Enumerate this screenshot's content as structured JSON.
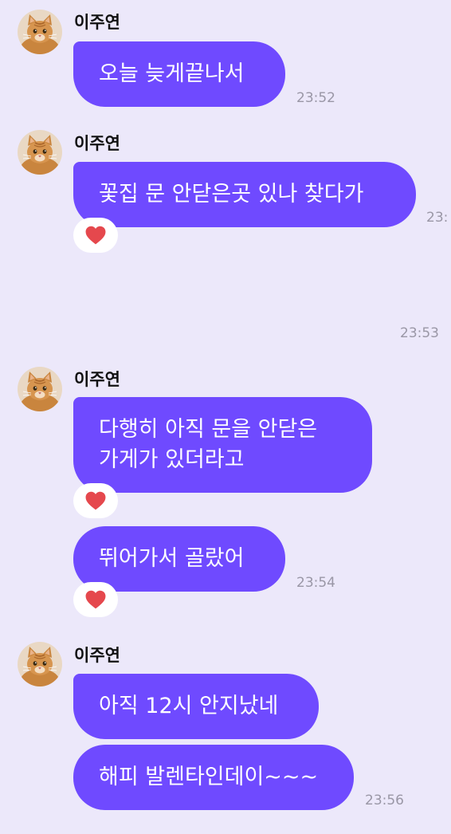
{
  "messages": [
    {
      "sender": "이주연",
      "lines": [
        "오늘 늦게끝나서"
      ],
      "time": "23:52"
    },
    {
      "sender": "이주연",
      "lines": [
        "꽃집 문 안닫은곳 있나 찾다가"
      ],
      "time": "23:"
    },
    {
      "time": "23:53"
    },
    {
      "sender": "이주연",
      "lines": [
        "다행히 아직 문을 안닫은",
        "가게가 있더라고"
      ]
    },
    {
      "lines": [
        "뛰어가서 골랐어"
      ],
      "time": "23:54"
    },
    {
      "sender": "이주연",
      "lines": [
        "아직 12시 안지났네"
      ]
    },
    {
      "lines": [
        "해피 발렌타인데이~~~"
      ],
      "time": "23:56"
    }
  ],
  "colors": {
    "background": "#ECE8FA",
    "bubble": "#6F4AFF",
    "heart": "#E5484D"
  },
  "icons": {
    "avatar": "cat-avatar-icon",
    "reaction": "heart-icon"
  }
}
